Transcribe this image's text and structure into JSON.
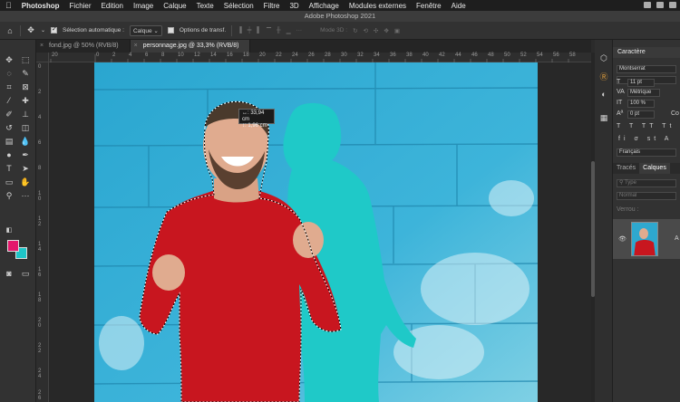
{
  "menubar": {
    "app": "Photoshop",
    "items": [
      "Fichier",
      "Edition",
      "Image",
      "Calque",
      "Texte",
      "Sélection",
      "Filtre",
      "3D",
      "Affichage",
      "Modules externes",
      "Fenêtre",
      "Aide"
    ]
  },
  "window": {
    "title": "Adobe Photoshop 2021"
  },
  "options": {
    "auto_select_label": "Sélection automatique :",
    "auto_select_value": "Calque",
    "transform_label": "Options de transf.",
    "mode3d_label": "Mode 3D :"
  },
  "tabs": [
    {
      "label": "fond.jpg @ 50% (RVB/8)"
    },
    {
      "label": "personnage.jpg @ 33,3% (RVB/8)"
    }
  ],
  "rulers": {
    "h": [
      "20",
      "0",
      "2",
      "4",
      "6",
      "8",
      "10",
      "12",
      "14",
      "16",
      "18",
      "20",
      "22",
      "24",
      "26",
      "28",
      "30",
      "32",
      "34",
      "36",
      "38",
      "40",
      "42",
      "44",
      "46",
      "48",
      "50",
      "52",
      "54",
      "56",
      "58"
    ],
    "v": [
      "0",
      "2",
      "4",
      "6",
      "8",
      "1\n0",
      "1\n2",
      "1\n4",
      "1\n6",
      "1\n8",
      "2\n0",
      "2\n2",
      "2\n4",
      "2\n6"
    ]
  },
  "tooltip": {
    "x": "↔: 33,94 cm",
    "y": "↕:  1,96 cm"
  },
  "character_panel": {
    "title": "Caractère",
    "font": "Montserrat",
    "size": "11 pt",
    "kerning": "Métrique",
    "scale": "100 %",
    "baseline": "0 pt",
    "language": "Français",
    "col_label": "Co"
  },
  "layers_panel": {
    "tabs": [
      "Tracés",
      "Calques"
    ],
    "search_placeholder": "Type",
    "blend_mode": "Normal",
    "lock_label": "Verrou :",
    "layer_label": "A"
  },
  "colors": {
    "foreground": "#e4176b",
    "background": "#1fc5c8"
  }
}
